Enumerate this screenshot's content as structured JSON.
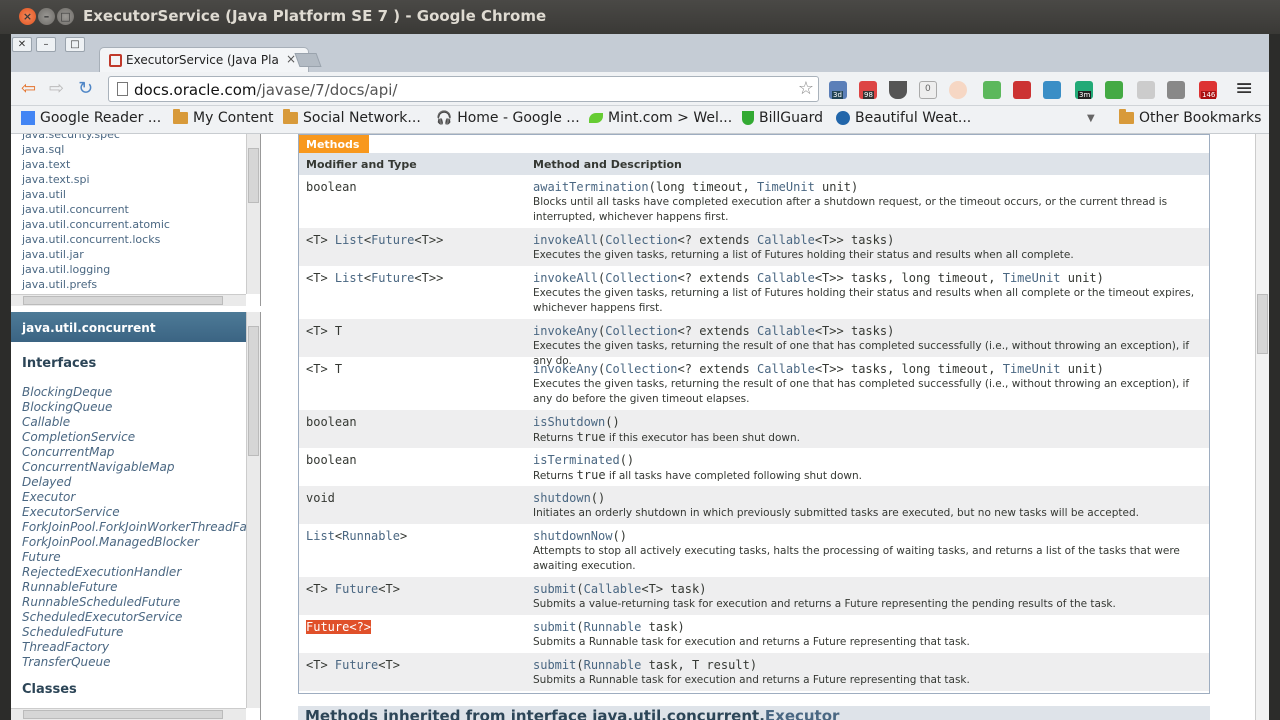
{
  "window": {
    "title": "ExecutorService (Java Platform SE 7 ) - Google Chrome"
  },
  "tab": {
    "title": "ExecutorService (Java Pla",
    "close": "×"
  },
  "toolbar": {
    "url_host": "docs.oracle.com",
    "url_path": "/javase/7/docs/api/",
    "back": "⇦",
    "forward": "⇨",
    "reload": "↻",
    "star": "☆",
    "menu": "≡"
  },
  "extensions": {
    "ext1": "3d",
    "ext2": "98",
    "ext3": "0",
    "ext4": "3m",
    "ext5": "146"
  },
  "bookmarks": [
    "Google Reader ...",
    "My Content",
    "Social Network...",
    "Home - Google ...",
    "Mint.com > Wel...",
    "BillGuard",
    "Beautiful Weat..."
  ],
  "other_bookmarks": "Other Bookmarks",
  "packages": [
    "java.security.spec",
    "java.sql",
    "java.text",
    "java.text.spi",
    "java.util",
    "java.util.concurrent",
    "java.util.concurrent.atomic",
    "java.util.concurrent.locks",
    "java.util.jar",
    "java.util.logging",
    "java.util.prefs"
  ],
  "class_frame": {
    "title": "java.util.concurrent",
    "interfaces_heading": "Interfaces",
    "interfaces": [
      "BlockingDeque",
      "BlockingQueue",
      "Callable",
      "CompletionService",
      "ConcurrentMap",
      "ConcurrentNavigableMap",
      "Delayed",
      "Executor",
      "ExecutorService",
      "ForkJoinPool.ForkJoinWorkerThreadFact",
      "ForkJoinPool.ManagedBlocker",
      "Future",
      "RejectedExecutionHandler",
      "RunnableFuture",
      "RunnableScheduledFuture",
      "ScheduledExecutorService",
      "ScheduledFuture",
      "ThreadFactory",
      "TransferQueue"
    ],
    "classes_heading": "Classes"
  },
  "methods": {
    "tab": "Methods",
    "col1": "Modifier and Type",
    "col2": "Method and Description",
    "rows": [
      {
        "type": "boolean",
        "sig": "awaitTermination(long timeout, TimeUnit unit)",
        "desc": "Blocks until all tasks have completed execution after a shutdown request, or the timeout occurs, or the current thread is interrupted, whichever happens first."
      },
      {
        "type": "<T> List<Future<T>>",
        "sig": "invokeAll(Collection<? extends Callable<T>> tasks)",
        "desc": "Executes the given tasks, returning a list of Futures holding their status and results when all complete."
      },
      {
        "type": "<T> List<Future<T>>",
        "sig": "invokeAll(Collection<? extends Callable<T>> tasks, long timeout, TimeUnit unit)",
        "desc": "Executes the given tasks, returning a list of Futures holding their status and results when all complete or the timeout expires, whichever happens first."
      },
      {
        "type": "<T> T",
        "sig": "invokeAny(Collection<? extends Callable<T>> tasks)",
        "desc": "Executes the given tasks, returning the result of one that has completed successfully (i.e., without throwing an exception), if any do."
      },
      {
        "type": "<T> T",
        "sig": "invokeAny(Collection<? extends Callable<T>> tasks, long timeout, TimeUnit unit)",
        "desc": "Executes the given tasks, returning the result of one that has completed successfully (i.e., without throwing an exception), if any do before the given timeout elapses."
      },
      {
        "type": "boolean",
        "sig": "isShutdown()",
        "desc_pre": "Returns ",
        "desc_code": "true",
        "desc_post": " if this executor has been shut down."
      },
      {
        "type": "boolean",
        "sig": "isTerminated()",
        "desc_pre": "Returns ",
        "desc_code": "true",
        "desc_post": " if all tasks have completed following shut down."
      },
      {
        "type": "void",
        "sig": "shutdown()",
        "desc": "Initiates an orderly shutdown in which previously submitted tasks are executed, but no new tasks will be accepted."
      },
      {
        "type": "List<Runnable>",
        "sig": "shutdownNow()",
        "desc": "Attempts to stop all actively executing tasks, halts the processing of waiting tasks, and returns a list of the tasks that were awaiting execution."
      },
      {
        "type": "<T> Future<T>",
        "sig": "submit(Callable<T> task)",
        "desc": "Submits a value-returning task for execution and returns a Future representing the pending results of the task."
      },
      {
        "type": "Future<?>",
        "sig": "submit(Runnable task)",
        "desc": "Submits a Runnable task for execution and returns a Future representing that task."
      },
      {
        "type": "<T> Future<T>",
        "sig": "submit(Runnable task, T result)",
        "desc": "Submits a Runnable task for execution and returns a Future representing that task."
      }
    ]
  },
  "inherited": {
    "prefix": "Methods inherited from interface java.util.concurrent.",
    "link": "Executor"
  }
}
